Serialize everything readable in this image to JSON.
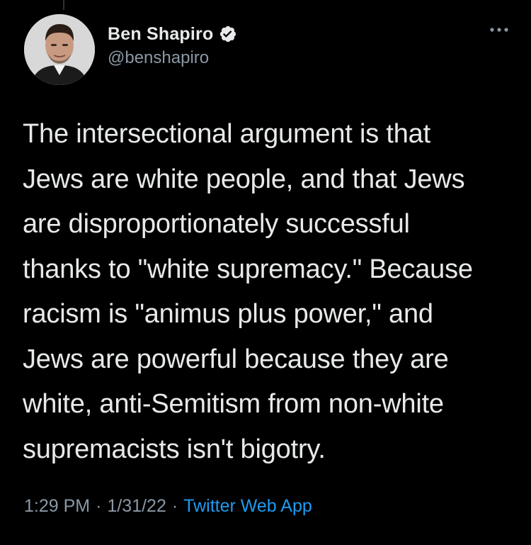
{
  "tweet": {
    "author": {
      "display_name": "Ben Shapiro",
      "handle": "@benshapiro",
      "verified": true,
      "avatar_icon": "profile-photo"
    },
    "text_lines": [
      "The intersectional argument is that",
      "Jews are white people, and that Jews",
      "are disproportionately successful",
      "thanks to \"white supremacy.\" Because",
      "racism is \"animus plus power,\" and",
      "Jews are powerful because they are",
      "white, anti-Semitism from non-white",
      "supremacists isn't bigotry."
    ],
    "meta": {
      "time": "1:29 PM",
      "separator_1": "·",
      "date": "1/31/22",
      "separator_2": "·",
      "source": "Twitter Web App"
    },
    "more_icon": "more-horizontal-icon"
  },
  "colors": {
    "background": "#000000",
    "text": "#e7e9ea",
    "secondary": "#8b98a5",
    "accent": "#1d9bf0"
  }
}
